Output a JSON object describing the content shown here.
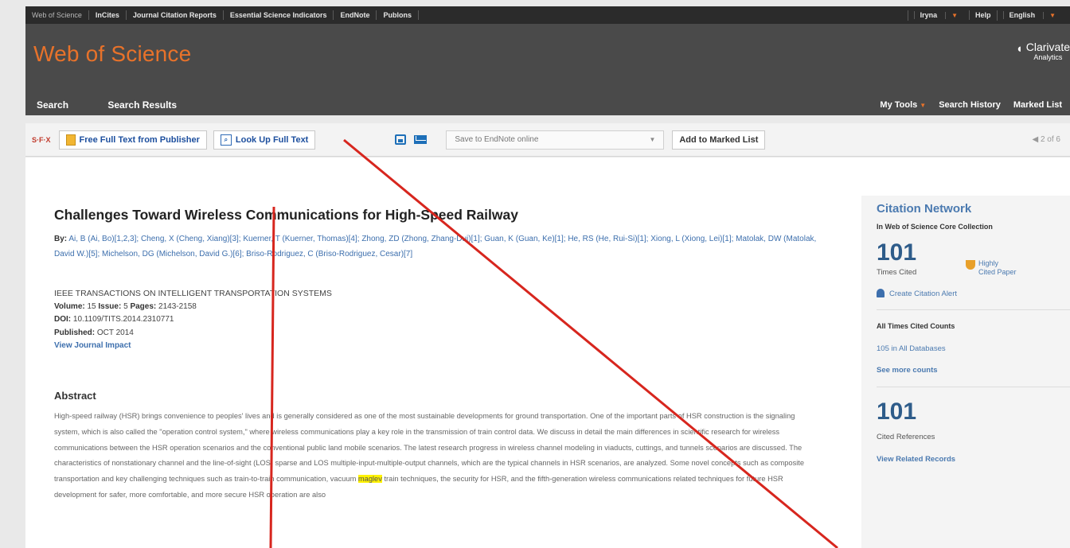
{
  "topbar": {
    "links": [
      "Web of Science",
      "InCites",
      "Journal Citation Reports",
      "Essential Science Indicators",
      "EndNote",
      "Publons"
    ],
    "user": "Iryna",
    "help": "Help",
    "language": "English"
  },
  "header": {
    "logo": "Web of Science",
    "brand": "Clarivate",
    "brand_sub": "Analytics",
    "nav_left": [
      "Search",
      "Search Results"
    ],
    "nav_right": [
      "My Tools",
      "Search History",
      "Marked List"
    ]
  },
  "toolbar": {
    "sfx_label": "S·F·X",
    "free_full_text": "Free Full Text from Publisher",
    "look_up": "Look Up Full Text",
    "save_select": "Save to EndNote online",
    "add_marked": "Add to Marked List",
    "pager": "◀ 2 of 6"
  },
  "record": {
    "title": "Challenges Toward Wireless Communications for High-Speed Railway",
    "by_label": "By:",
    "authors_text": "Ai, B (Ai, Bo)[1,2,3]; Cheng, X (Cheng, Xiang)[3]; Kuerner, T (Kuerner, Thomas)[4]; Zhong, ZD (Zhong, Zhang-Dui)[1]; Guan, K (Guan, Ke)[1]; He, RS (He, Rui-Si)[1]; Xiong, L (Xiong, Lei)[1]; Matolak, DW (Matolak, David W.)[5]; Michelson, DG (Michelson, David G.)[6]; Briso-Rodriguez, C (Briso-Rodriguez, Cesar)[7]",
    "journal": "IEEE TRANSACTIONS ON INTELLIGENT TRANSPORTATION SYSTEMS",
    "volume_label": "Volume:",
    "volume": "15",
    "issue_label": "Issue:",
    "issue": "5",
    "pages_label": "Pages:",
    "pages": "2143-2158",
    "doi_label": "DOI:",
    "doi": "10.1109/TITS.2014.2310771",
    "published_label": "Published:",
    "published": "OCT 2014",
    "journal_impact": "View Journal Impact",
    "abstract_heading": "Abstract",
    "abstract_before": "High-speed railway (HSR) brings convenience to peoples' lives and is generally considered as one of the most sustainable developments for ground transportation. One of the important parts of HSR construction is the signaling system, which is also called the \"operation control system,\" where wireless communications play a key role in the transmission of train control data. We discuss in detail the main differences in scientific research for wireless communications between the HSR operation scenarios and the conventional public land mobile scenarios. The latest research progress in wireless channel modeling in viaducts, cuttings, and tunnels scenarios are discussed. The characteristics of nonstationary channel and the line-of-sight (LOS) sparse and LOS multiple-input-multiple-output channels, which are the typical channels in HSR scenarios, are analyzed. Some novel concepts such as composite transportation and key challenging techniques such as train-to-train communication, vacuum ",
    "abstract_highlight": "maglev",
    "abstract_after": " train techniques, the security for HSR, and the fifth-generation wireless communications related techniques for future HSR development for safer, more comfortable, and more secure HSR operation are also"
  },
  "citation": {
    "heading": "Citation Network",
    "scope": "In Web of Science Core Collection",
    "times_cited": "101",
    "times_cited_label": "Times Cited",
    "highly_cited": "Highly Cited Paper",
    "create_alert": "Create Citation Alert",
    "all_counts_label": "All Times Cited Counts",
    "all_databases": "105 in All Databases",
    "see_more": "See more counts",
    "cited_refs": "101",
    "cited_refs_label": "Cited References",
    "related": "View Related Records"
  }
}
